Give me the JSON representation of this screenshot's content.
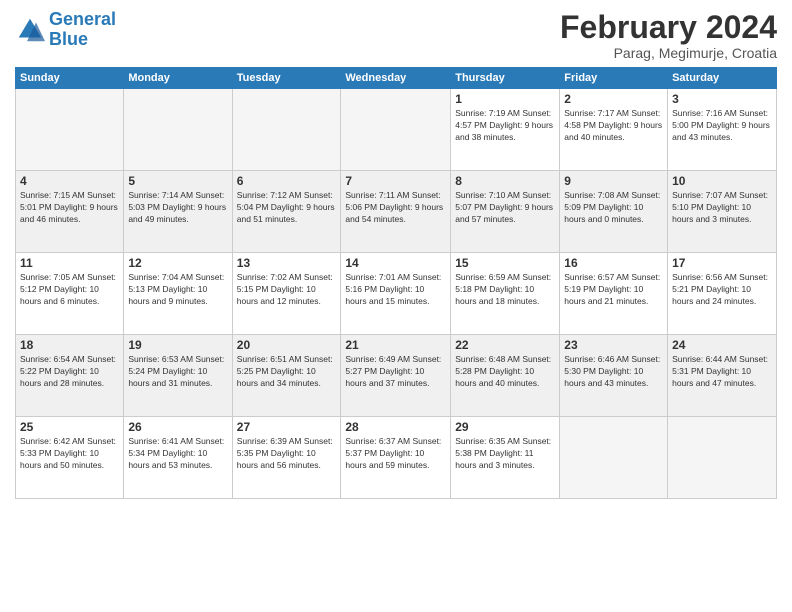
{
  "logo": {
    "line1": "General",
    "line2": "Blue"
  },
  "title": "February 2024",
  "subtitle": "Parag, Megimurje, Croatia",
  "weekdays": [
    "Sunday",
    "Monday",
    "Tuesday",
    "Wednesday",
    "Thursday",
    "Friday",
    "Saturday"
  ],
  "weeks": [
    {
      "shaded": false,
      "days": [
        {
          "num": "",
          "info": "",
          "empty": true
        },
        {
          "num": "",
          "info": "",
          "empty": true
        },
        {
          "num": "",
          "info": "",
          "empty": true
        },
        {
          "num": "",
          "info": "",
          "empty": true
        },
        {
          "num": "1",
          "info": "Sunrise: 7:19 AM\nSunset: 4:57 PM\nDaylight: 9 hours\nand 38 minutes.",
          "empty": false
        },
        {
          "num": "2",
          "info": "Sunrise: 7:17 AM\nSunset: 4:58 PM\nDaylight: 9 hours\nand 40 minutes.",
          "empty": false
        },
        {
          "num": "3",
          "info": "Sunrise: 7:16 AM\nSunset: 5:00 PM\nDaylight: 9 hours\nand 43 minutes.",
          "empty": false
        }
      ]
    },
    {
      "shaded": true,
      "days": [
        {
          "num": "4",
          "info": "Sunrise: 7:15 AM\nSunset: 5:01 PM\nDaylight: 9 hours\nand 46 minutes.",
          "empty": false
        },
        {
          "num": "5",
          "info": "Sunrise: 7:14 AM\nSunset: 5:03 PM\nDaylight: 9 hours\nand 49 minutes.",
          "empty": false
        },
        {
          "num": "6",
          "info": "Sunrise: 7:12 AM\nSunset: 5:04 PM\nDaylight: 9 hours\nand 51 minutes.",
          "empty": false
        },
        {
          "num": "7",
          "info": "Sunrise: 7:11 AM\nSunset: 5:06 PM\nDaylight: 9 hours\nand 54 minutes.",
          "empty": false
        },
        {
          "num": "8",
          "info": "Sunrise: 7:10 AM\nSunset: 5:07 PM\nDaylight: 9 hours\nand 57 minutes.",
          "empty": false
        },
        {
          "num": "9",
          "info": "Sunrise: 7:08 AM\nSunset: 5:09 PM\nDaylight: 10 hours\nand 0 minutes.",
          "empty": false
        },
        {
          "num": "10",
          "info": "Sunrise: 7:07 AM\nSunset: 5:10 PM\nDaylight: 10 hours\nand 3 minutes.",
          "empty": false
        }
      ]
    },
    {
      "shaded": false,
      "days": [
        {
          "num": "11",
          "info": "Sunrise: 7:05 AM\nSunset: 5:12 PM\nDaylight: 10 hours\nand 6 minutes.",
          "empty": false
        },
        {
          "num": "12",
          "info": "Sunrise: 7:04 AM\nSunset: 5:13 PM\nDaylight: 10 hours\nand 9 minutes.",
          "empty": false
        },
        {
          "num": "13",
          "info": "Sunrise: 7:02 AM\nSunset: 5:15 PM\nDaylight: 10 hours\nand 12 minutes.",
          "empty": false
        },
        {
          "num": "14",
          "info": "Sunrise: 7:01 AM\nSunset: 5:16 PM\nDaylight: 10 hours\nand 15 minutes.",
          "empty": false
        },
        {
          "num": "15",
          "info": "Sunrise: 6:59 AM\nSunset: 5:18 PM\nDaylight: 10 hours\nand 18 minutes.",
          "empty": false
        },
        {
          "num": "16",
          "info": "Sunrise: 6:57 AM\nSunset: 5:19 PM\nDaylight: 10 hours\nand 21 minutes.",
          "empty": false
        },
        {
          "num": "17",
          "info": "Sunrise: 6:56 AM\nSunset: 5:21 PM\nDaylight: 10 hours\nand 24 minutes.",
          "empty": false
        }
      ]
    },
    {
      "shaded": true,
      "days": [
        {
          "num": "18",
          "info": "Sunrise: 6:54 AM\nSunset: 5:22 PM\nDaylight: 10 hours\nand 28 minutes.",
          "empty": false
        },
        {
          "num": "19",
          "info": "Sunrise: 6:53 AM\nSunset: 5:24 PM\nDaylight: 10 hours\nand 31 minutes.",
          "empty": false
        },
        {
          "num": "20",
          "info": "Sunrise: 6:51 AM\nSunset: 5:25 PM\nDaylight: 10 hours\nand 34 minutes.",
          "empty": false
        },
        {
          "num": "21",
          "info": "Sunrise: 6:49 AM\nSunset: 5:27 PM\nDaylight: 10 hours\nand 37 minutes.",
          "empty": false
        },
        {
          "num": "22",
          "info": "Sunrise: 6:48 AM\nSunset: 5:28 PM\nDaylight: 10 hours\nand 40 minutes.",
          "empty": false
        },
        {
          "num": "23",
          "info": "Sunrise: 6:46 AM\nSunset: 5:30 PM\nDaylight: 10 hours\nand 43 minutes.",
          "empty": false
        },
        {
          "num": "24",
          "info": "Sunrise: 6:44 AM\nSunset: 5:31 PM\nDaylight: 10 hours\nand 47 minutes.",
          "empty": false
        }
      ]
    },
    {
      "shaded": false,
      "days": [
        {
          "num": "25",
          "info": "Sunrise: 6:42 AM\nSunset: 5:33 PM\nDaylight: 10 hours\nand 50 minutes.",
          "empty": false
        },
        {
          "num": "26",
          "info": "Sunrise: 6:41 AM\nSunset: 5:34 PM\nDaylight: 10 hours\nand 53 minutes.",
          "empty": false
        },
        {
          "num": "27",
          "info": "Sunrise: 6:39 AM\nSunset: 5:35 PM\nDaylight: 10 hours\nand 56 minutes.",
          "empty": false
        },
        {
          "num": "28",
          "info": "Sunrise: 6:37 AM\nSunset: 5:37 PM\nDaylight: 10 hours\nand 59 minutes.",
          "empty": false
        },
        {
          "num": "29",
          "info": "Sunrise: 6:35 AM\nSunset: 5:38 PM\nDaylight: 11 hours\nand 3 minutes.",
          "empty": false
        },
        {
          "num": "",
          "info": "",
          "empty": true
        },
        {
          "num": "",
          "info": "",
          "empty": true
        }
      ]
    }
  ]
}
